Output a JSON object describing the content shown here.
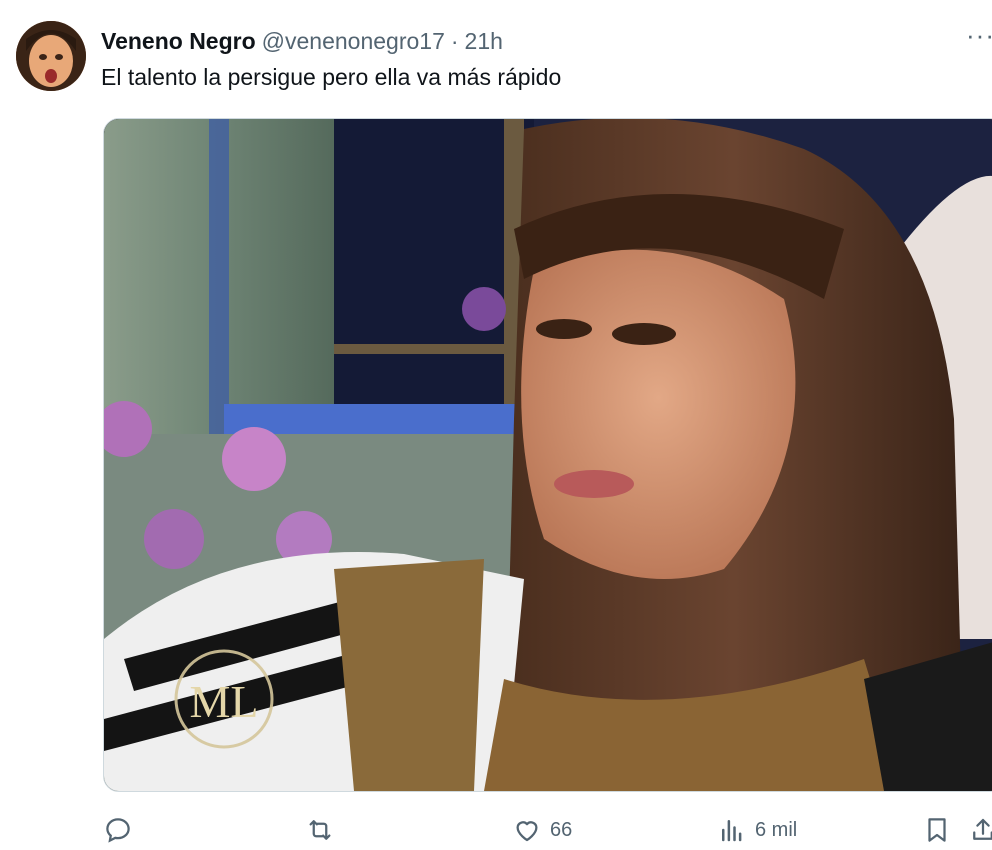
{
  "tweet": {
    "display_name": "Veneno Negro",
    "handle": "@venenonegro17",
    "separator": "·",
    "time": "21h",
    "more_label": "···",
    "text": "El talento la persigue pero ella va más rápido",
    "media": {
      "type": "image",
      "watermark": "ML"
    }
  },
  "actions": {
    "reply": {
      "icon": "reply-icon",
      "count": ""
    },
    "retweet": {
      "icon": "retweet-icon",
      "count": ""
    },
    "like": {
      "icon": "heart-icon",
      "count": "66"
    },
    "views": {
      "icon": "views-icon",
      "count": "6 mil"
    },
    "bookmark": {
      "icon": "bookmark-icon"
    },
    "share": {
      "icon": "share-icon"
    }
  },
  "colors": {
    "text_primary": "#0f1419",
    "text_secondary": "#536471",
    "border": "#cfd9de"
  }
}
